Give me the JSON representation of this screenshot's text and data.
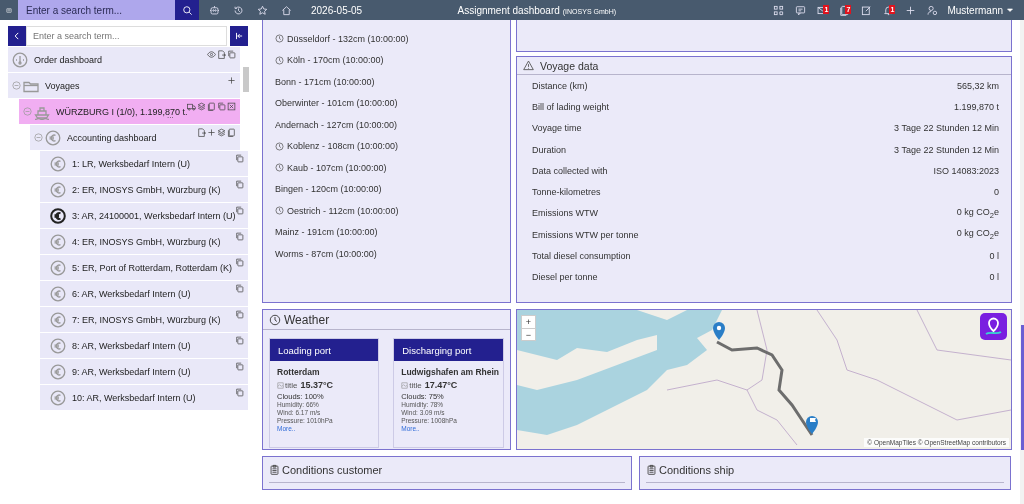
{
  "topbar": {
    "search_placeholder": "Enter a search term...",
    "date": "2026-05-05",
    "title": "Assignment dashboard",
    "company": "(INOSYS GmbH)",
    "badges": [
      {
        "kind": "mail",
        "count": "1"
      },
      {
        "kind": "documents",
        "count": "7"
      },
      {
        "kind": "bell",
        "count": "1"
      }
    ],
    "user": "Mustermann"
  },
  "sidebar": {
    "search_placeholder": "Enter a search term...",
    "items": [
      {
        "kind": "dashboard",
        "label": "Order dashboard",
        "selected": false
      },
      {
        "kind": "folder",
        "label": "Voyages",
        "expanded": true,
        "selected": false,
        "children": [
          {
            "kind": "voyage",
            "label": "WÜRZBURG I (1/0), 1.199,870 t.",
            "more": "...",
            "expanded": true,
            "selected": true,
            "children": [
              {
                "kind": "accounting",
                "label": "Accounting dashboard",
                "expanded": true,
                "selected": false,
                "children": [
                  {
                    "kind": "invoice",
                    "label": "1: LR, Werksbedarf Intern (U)",
                    "active": false,
                    "selected": false
                  },
                  {
                    "kind": "invoice",
                    "label": "2: ER, INOSYS GmbH, Würzburg (K)",
                    "active": false,
                    "selected": false
                  },
                  {
                    "kind": "invoice",
                    "label": "3: AR, 24100001, Werksbedarf Intern (U)",
                    "active": true,
                    "selected": false
                  },
                  {
                    "kind": "invoice",
                    "label": "4: ER, INOSYS GmbH, Würzburg (K)",
                    "active": false,
                    "selected": false
                  },
                  {
                    "kind": "invoice",
                    "label": "5: ER, Port of Rotterdam, Rotterdam (K)",
                    "active": false,
                    "selected": false
                  },
                  {
                    "kind": "invoice",
                    "label": "6: AR, Werksbedarf Intern (U)",
                    "active": false,
                    "selected": false
                  },
                  {
                    "kind": "invoice",
                    "label": "7: ER, INOSYS GmbH, Würzburg (K)",
                    "active": false,
                    "selected": false
                  },
                  {
                    "kind": "invoice",
                    "label": "8: AR, Werksbedarf Intern (U)",
                    "active": false,
                    "selected": false
                  },
                  {
                    "kind": "invoice",
                    "label": "9: AR, Werksbedarf Intern (U)",
                    "active": false,
                    "selected": false
                  },
                  {
                    "kind": "invoice",
                    "label": "10: AR, Werksbedarf Intern (U)",
                    "active": false,
                    "selected": false
                  }
                ]
              }
            ]
          }
        ]
      }
    ]
  },
  "water_levels": [
    {
      "text": "Düsseldorf - 132cm (10:00:00)",
      "clock": true
    },
    {
      "text": "Köln - 170cm (10:00:00)",
      "clock": true
    },
    {
      "text": "Bonn - 171cm (10:00:00)",
      "clock": false
    },
    {
      "text": "Oberwinter - 101cm (10:00:00)",
      "clock": false
    },
    {
      "text": "Andernach - 127cm (10:00:00)",
      "clock": false
    },
    {
      "text": "Koblenz - 108cm (10:00:00)",
      "clock": true
    },
    {
      "text": "Kaub - 107cm (10:00:00)",
      "clock": true
    },
    {
      "text": "Bingen - 120cm (10:00:00)",
      "clock": false
    },
    {
      "text": "Oestrich - 112cm (10:00:00)",
      "clock": true
    },
    {
      "text": "Mainz - 191cm (10:00:00)",
      "clock": false
    },
    {
      "text": "Worms - 87cm (10:00:00)",
      "clock": false
    }
  ],
  "voyage_data": {
    "title": "Voyage data",
    "rows": [
      {
        "label": "Distance (km)",
        "value": "565,32 km"
      },
      {
        "label": "Bill of lading weight",
        "value": "1.199,870 t"
      },
      {
        "label": "Voyage time",
        "value": "3 Tage 22 Stunden 12 Min"
      },
      {
        "label": "Duration",
        "value": "3 Tage 22 Stunden 12 Min"
      },
      {
        "label": "Data collected with",
        "value": "ISO 14083:2023"
      },
      {
        "label": "Tonne-kilometres",
        "value": "0"
      },
      {
        "label": "Emissions WTW",
        "value": "0 kg CO$_{2}$e"
      },
      {
        "label": "Emissions WTW per tonne",
        "value": "0 kg CO$_{2}$e"
      },
      {
        "label": "Total diesel consumption",
        "value": "0 l"
      },
      {
        "label": "Diesel per tonne",
        "value": "0 l"
      }
    ]
  },
  "weather": {
    "title": "Weather",
    "cards": [
      {
        "header": "Loading port",
        "city": "Rotterdam",
        "image_alt": "title",
        "temperature": "15.37°C",
        "clouds": "Clouds: 100%",
        "humidity": "Humidity: 66%",
        "wind": "Wind: 6.17 m/s",
        "pressure": "Pressure: 1010hPa",
        "link": "More.."
      },
      {
        "header": "Discharging port",
        "city": "Ludwigshafen am Rhein",
        "image_alt": "title",
        "temperature": "17.47°C",
        "clouds": "Clouds: 75%",
        "humidity": "Humidity: 78%",
        "wind": "Wind: 3.09 m/s",
        "pressure": "Pressure: 1008hPa",
        "link": "More.."
      }
    ]
  },
  "map": {
    "zoom_in": "+",
    "zoom_out": "−",
    "attribution": "© OpenMapTiles © OpenStreetMap contributors"
  },
  "conditions": [
    {
      "title": "Conditions customer"
    },
    {
      "title": "Conditions ship"
    }
  ]
}
